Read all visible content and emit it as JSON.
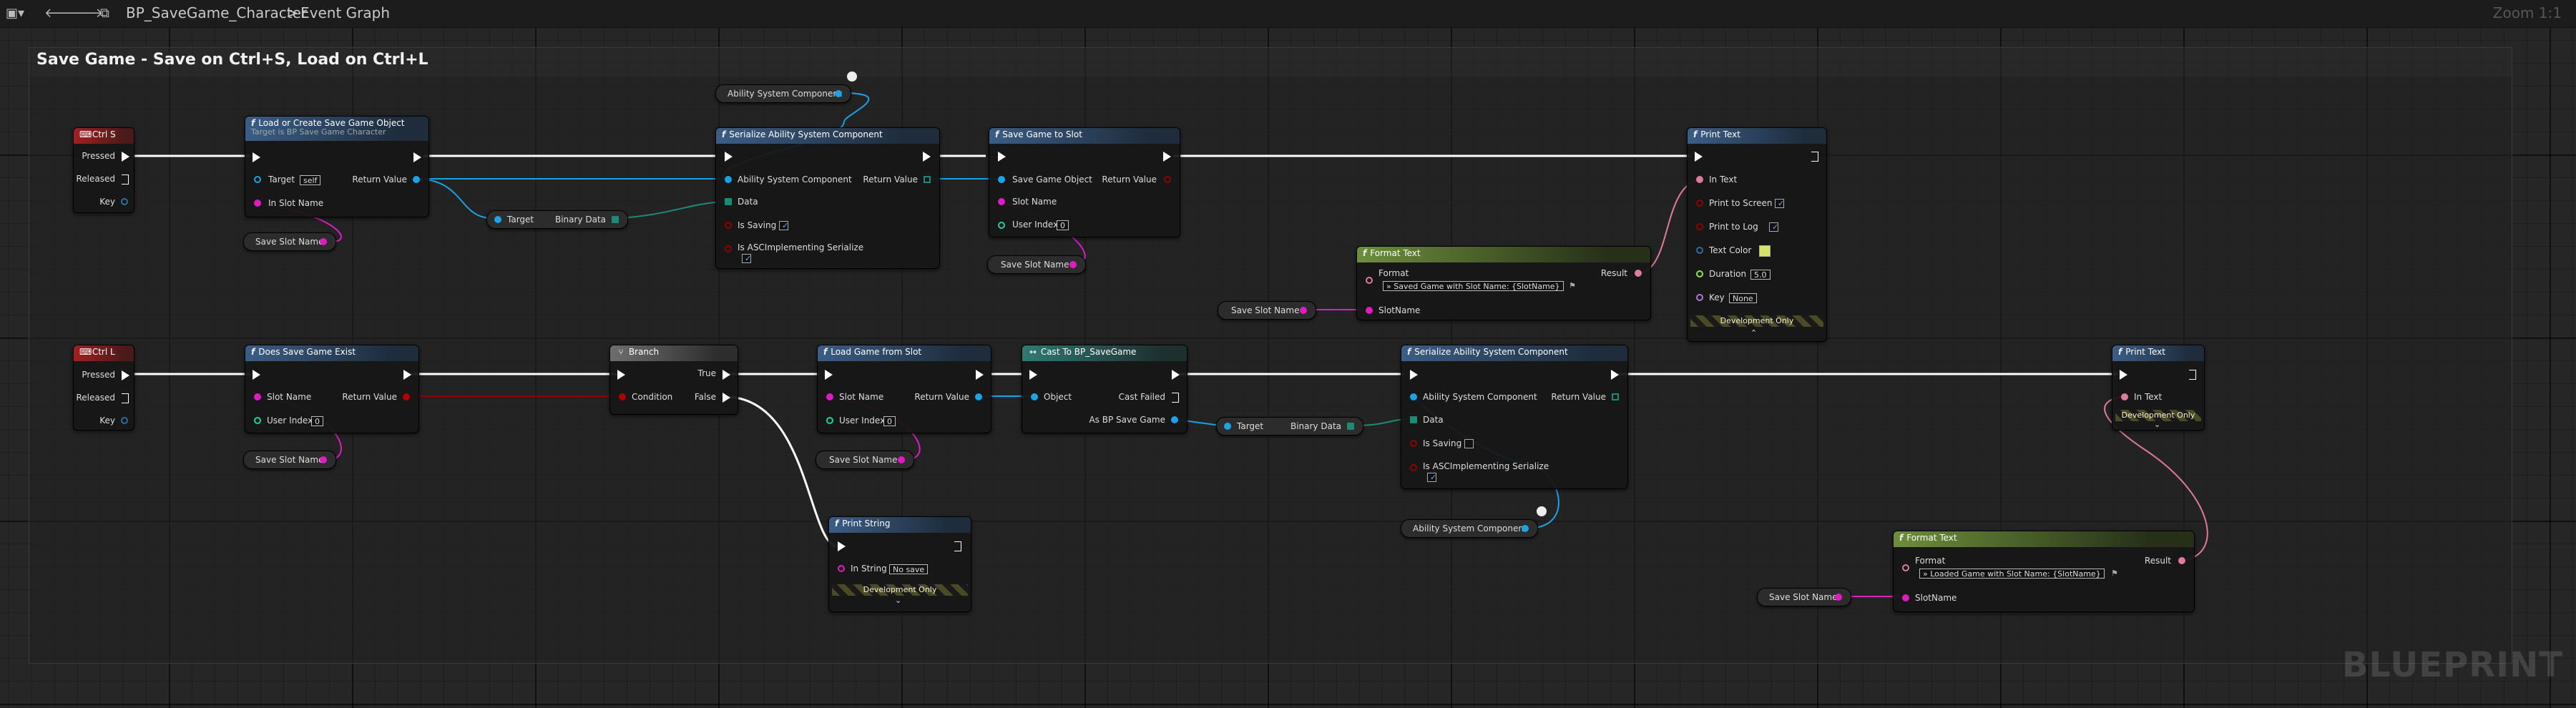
{
  "toolbar": {
    "logo_icon": "blueprint-menu-icon",
    "back_icon": "arrow-left-icon",
    "forward_icon": "arrow-right-icon",
    "graph_icon": "graph-icon",
    "breadcrumb_asset": "BP_SaveGame_Character",
    "breadcrumb_sep": ">",
    "breadcrumb_graph": "Event Graph",
    "zoom": "Zoom 1:1"
  },
  "comment": {
    "title": "Save Game - Save on Ctrl+S, Load on Ctrl+L"
  },
  "watermark": "BLUEPRINT",
  "nodes": {
    "ctrl_s": {
      "title": "Ctrl S",
      "pressed": "Pressed",
      "released": "Released",
      "key": "Key"
    },
    "ctrl_l": {
      "title": "Ctrl L",
      "pressed": "Pressed",
      "released": "Released",
      "key": "Key"
    },
    "load_create": {
      "title": "Load or Create Save Game Object",
      "subtitle": "Target is BP Save Game Character",
      "target": "Target",
      "target_default": "self",
      "return": "Return Value",
      "in_slot": "In Slot Name"
    },
    "serialize_top": {
      "title": "Serialize Ability System Component",
      "asc": "Ability System Component",
      "return": "Return Value",
      "data": "Data",
      "is_saving": "Is Saving",
      "is_asc": "Is ASCImplementing Serialize"
    },
    "save_to_slot": {
      "title": "Save Game to Slot",
      "sgo": "Save Game Object",
      "return": "Return Value",
      "slot": "Slot Name",
      "user": "User Index",
      "user_default": "0"
    },
    "print_text_top": {
      "title": "Print Text",
      "in_text": "In Text",
      "print_screen": "Print to Screen",
      "print_log": "Print to Log",
      "text_color": "Text Color",
      "duration": "Duration",
      "duration_default": "5.0",
      "key": "Key",
      "key_default": "None",
      "dev_only": "Development Only"
    },
    "format_top": {
      "title": "Format Text",
      "format": "Format",
      "result": "Result",
      "format_value": "» Saved Game with Slot Name: {SlotName}",
      "slot_name": "SlotName"
    },
    "does_exist": {
      "title": "Does Save Game Exist",
      "slot": "Slot Name",
      "return": "Return Value",
      "user": "User Index",
      "user_default": "0"
    },
    "branch": {
      "title": "Branch",
      "condition": "Condition",
      "true": "True",
      "false": "False"
    },
    "load_from_slot": {
      "title": "Load Game from Slot",
      "slot": "Slot Name",
      "return": "Return Value",
      "user": "User Index",
      "user_default": "0"
    },
    "cast": {
      "title": "Cast To BP_SaveGame",
      "object": "Object",
      "cast_failed": "Cast Failed",
      "as": "As BP Save Game"
    },
    "serialize_bottom": {
      "title": "Serialize Ability System Component",
      "asc": "Ability System Component",
      "return": "Return Value",
      "data": "Data",
      "is_saving": "Is Saving",
      "is_asc": "Is ASCImplementing Serialize"
    },
    "print_text_bottom": {
      "title": "Print Text",
      "in_text": "In Text",
      "dev_only": "Development Only"
    },
    "print_string": {
      "title": "Print String",
      "in_string": "In String",
      "in_string_default": "No save",
      "dev_only": "Development Only"
    },
    "format_bottom": {
      "title": "Format Text",
      "format": "Format",
      "result": "Result",
      "format_value": "» Loaded Game with Slot Name: {SlotName}",
      "slot_name": "SlotName"
    }
  },
  "pills": {
    "asc_top": "Ability System Component",
    "asc_bottom": "Ability System Component",
    "save_slot": "Save Slot Name",
    "binary_target": "Target",
    "binary_data": "Binary Data"
  },
  "colors": {
    "exec": "#ffffff",
    "object": "#00a8f0",
    "string": "#f000c8",
    "text": "#e07aa0",
    "bool": "#930000",
    "struct": "#2a6f9a",
    "byte": "#0f6f5d"
  }
}
